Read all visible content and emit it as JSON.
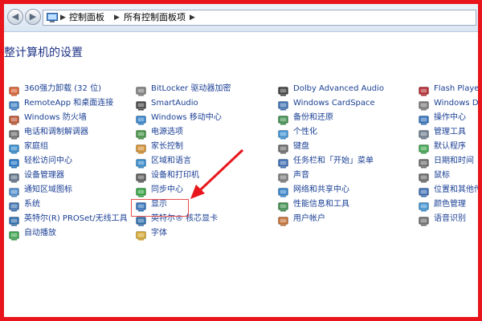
{
  "window": {
    "breadcrumb": [
      "控制面板",
      "所有控制面板项"
    ],
    "heading": "整计算机的设置"
  },
  "columns": [
    {
      "items": [
        {
          "label": "360强力卸载 (32 位)",
          "icon": "uninstall-icon",
          "color": "#d35a2a"
        },
        {
          "label": "RemoteApp 和桌面连接",
          "icon": "remote-desktop-icon",
          "color": "#3b7dc4"
        },
        {
          "label": "Windows 防火墙",
          "icon": "firewall-icon",
          "color": "#b8502d"
        },
        {
          "label": "电话和调制解调器",
          "icon": "phone-modem-icon",
          "color": "#6a6a6a"
        },
        {
          "label": "家庭组",
          "icon": "homegroup-icon",
          "color": "#2f86c8"
        },
        {
          "label": "轻松访问中心",
          "icon": "ease-of-access-icon",
          "color": "#1f73c4"
        },
        {
          "label": "设备管理器",
          "icon": "device-manager-icon",
          "color": "#5a6d84"
        },
        {
          "label": "通知区域图标",
          "icon": "notification-area-icon",
          "color": "#4a89c8"
        },
        {
          "label": "系统",
          "icon": "system-icon",
          "color": "#3b6fb0"
        },
        {
          "label": "英特尔(R) PROSet/无线工具",
          "icon": "wireless-icon",
          "color": "#2a6aa8"
        },
        {
          "label": "自动播放",
          "icon": "autoplay-icon",
          "color": "#3aa04a"
        }
      ]
    },
    {
      "items": [
        {
          "label": "BitLocker 驱动器加密",
          "icon": "bitlocker-icon",
          "color": "#7a7a7a"
        },
        {
          "label": "SmartAudio",
          "icon": "audio-icon",
          "color": "#444444"
        },
        {
          "label": "Windows 移动中心",
          "icon": "mobility-center-icon",
          "color": "#2f7fc8"
        },
        {
          "label": "电源选项",
          "icon": "power-options-icon",
          "color": "#3f8f3f"
        },
        {
          "label": "家长控制",
          "icon": "parental-controls-icon",
          "color": "#d08a2a"
        },
        {
          "label": "区域和语言",
          "icon": "region-language-icon",
          "color": "#2f86c8"
        },
        {
          "label": "设备和打印机",
          "icon": "printer-icon",
          "color": "#555555"
        },
        {
          "label": "同步中心",
          "icon": "sync-center-icon",
          "color": "#2e9e3e"
        },
        {
          "label": "显示",
          "icon": "display-icon",
          "color": "#2f6fb8"
        },
        {
          "label": "英特尔® 核芯显卡",
          "icon": "graphics-icon",
          "color": "#2a6aa8"
        },
        {
          "label": "字体",
          "icon": "fonts-icon",
          "color": "#d4a42a"
        }
      ]
    },
    {
      "items": [
        {
          "label": "Dolby Advanced Audio",
          "icon": "dolby-icon",
          "color": "#3a3a3a"
        },
        {
          "label": "Windows CardSpace",
          "icon": "cardspace-icon",
          "color": "#3b6fb0"
        },
        {
          "label": "备份和还原",
          "icon": "backup-icon",
          "color": "#3a8a4a"
        },
        {
          "label": "个性化",
          "icon": "personalization-icon",
          "color": "#3b8fd0"
        },
        {
          "label": "键盘",
          "icon": "keyboard-icon",
          "color": "#666666"
        },
        {
          "label": "任务栏和「开始」菜单",
          "icon": "taskbar-icon",
          "color": "#3a6ab0"
        },
        {
          "label": "声音",
          "icon": "sound-icon",
          "color": "#777777"
        },
        {
          "label": "网络和共享中心",
          "icon": "network-icon",
          "color": "#2f7fc8"
        },
        {
          "label": "性能信息和工具",
          "icon": "performance-icon",
          "color": "#3a8a4a"
        },
        {
          "label": "用户帐户",
          "icon": "user-accounts-icon",
          "color": "#c06a30"
        }
      ]
    },
    {
      "items": [
        {
          "label": "Flash Player (",
          "icon": "flash-icon",
          "color": "#b0242a"
        },
        {
          "label": "Windows Defe",
          "icon": "defender-icon",
          "color": "#777777"
        },
        {
          "label": "操作中心",
          "icon": "action-center-icon",
          "color": "#2f6fb8"
        },
        {
          "label": "管理工具",
          "icon": "admin-tools-icon",
          "color": "#6a7a8a"
        },
        {
          "label": "默认程序",
          "icon": "default-programs-icon",
          "color": "#3aa04a"
        },
        {
          "label": "日期和时间",
          "icon": "date-time-icon",
          "color": "#6a6a6a"
        },
        {
          "label": "鼠标",
          "icon": "mouse-icon",
          "color": "#666666"
        },
        {
          "label": "位置和其他传感器",
          "icon": "sensors-icon",
          "color": "#3a6ab0"
        },
        {
          "label": "颜色管理",
          "icon": "color-management-icon",
          "color": "#3b8fd0"
        },
        {
          "label": "语音识别",
          "icon": "speech-recognition-icon",
          "color": "#6a6a6a"
        }
      ]
    }
  ],
  "annotation": {
    "color": "#e8161c"
  }
}
